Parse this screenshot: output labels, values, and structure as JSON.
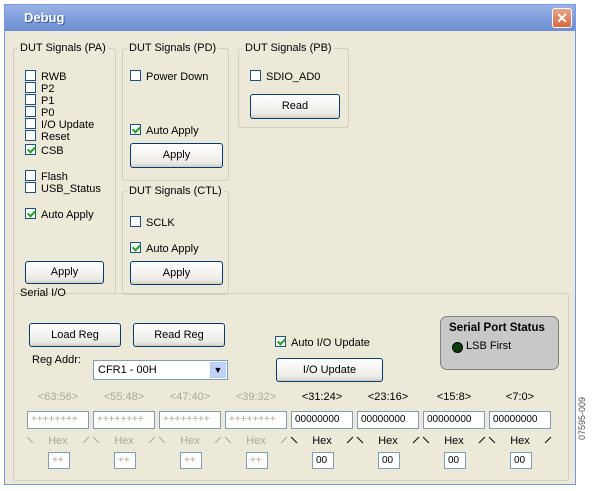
{
  "window": {
    "title": "Debug",
    "close_glyph": "✕"
  },
  "pa": {
    "legend": "DUT Signals (PA)",
    "items": [
      {
        "label": "RWB",
        "checked": false
      },
      {
        "label": "P2",
        "checked": false
      },
      {
        "label": "P1",
        "checked": false
      },
      {
        "label": "P0",
        "checked": false
      },
      {
        "label": "I/O Update",
        "checked": false
      },
      {
        "label": "Reset",
        "checked": false
      },
      {
        "label": "CSB",
        "checked": true
      },
      {
        "label": "Flash",
        "checked": false
      },
      {
        "label": "USB_Status",
        "checked": false
      },
      {
        "label": "Auto Apply",
        "checked": true
      }
    ],
    "apply_label": "Apply"
  },
  "pd": {
    "legend": "DUT Signals (PD)",
    "items": [
      {
        "label": "Power Down",
        "checked": false
      },
      {
        "label": "Auto Apply",
        "checked": true
      }
    ],
    "apply_label": "Apply"
  },
  "ctl": {
    "legend": "DUT Signals (CTL)",
    "items": [
      {
        "label": "SCLK",
        "checked": false
      },
      {
        "label": "Auto Apply",
        "checked": true
      }
    ],
    "apply_label": "Apply"
  },
  "pb": {
    "legend": "DUT Signals (PB)",
    "items": [
      {
        "label": "SDIO_AD0",
        "checked": false
      }
    ],
    "read_label": "Read"
  },
  "serial": {
    "legend": "Serial I/O",
    "load_reg_label": "Load Reg",
    "read_reg_label": "Read Reg",
    "reg_addr_label": "Reg Addr:",
    "reg_addr_value": "CFR1 - 00H",
    "auto_io_update_label": "Auto I/O Update",
    "auto_io_update_checked": true,
    "io_update_label": "I/O Update",
    "status": {
      "title": "Serial Port Status",
      "lsb_label": "LSB First",
      "led_color": "#0b3d0b"
    },
    "columns": [
      {
        "label": "<63:56>",
        "value": "++++++++",
        "hex": "++",
        "enabled": false
      },
      {
        "label": "<55:48>",
        "value": "++++++++",
        "hex": "++",
        "enabled": false
      },
      {
        "label": "<47:40>",
        "value": "++++++++",
        "hex": "++",
        "enabled": false
      },
      {
        "label": "<39:32>",
        "value": "++++++++",
        "hex": "++",
        "enabled": false
      },
      {
        "label": "<31:24>",
        "value": "00000000",
        "hex": "00",
        "enabled": true
      },
      {
        "label": "<23:16>",
        "value": "00000000",
        "hex": "00",
        "enabled": true
      },
      {
        "label": "<15:8>",
        "value": "00000000",
        "hex": "00",
        "enabled": true
      },
      {
        "label": "<7:0>",
        "value": "00000000",
        "hex": "00",
        "enabled": true
      }
    ],
    "hex_caption": "Hex"
  },
  "figure_id": "07595-009"
}
